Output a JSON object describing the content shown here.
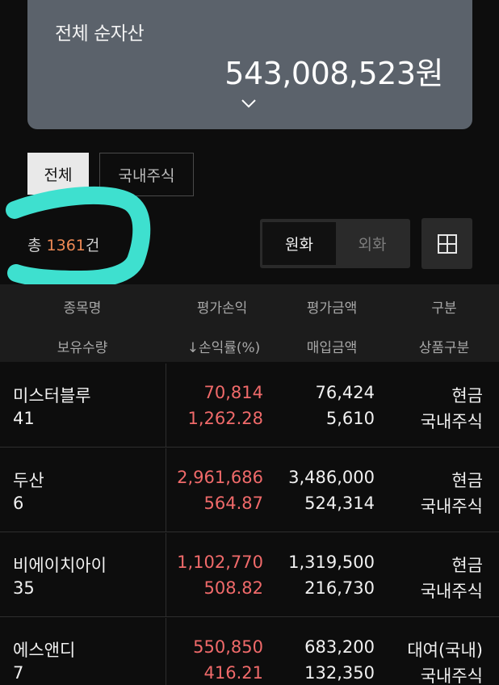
{
  "summary": {
    "title": "전체 순자산",
    "amount": "543,008,523원"
  },
  "tabs": {
    "all": "전체",
    "domestic": "국내주식"
  },
  "count": {
    "prefix": "총 ",
    "value": "1361",
    "suffix": "건"
  },
  "currency": {
    "krw": "원화",
    "fx": "외화"
  },
  "headers": {
    "row1": [
      "종목명",
      "평가손익",
      "평가금액",
      "구분"
    ],
    "row2": [
      "보유수량",
      "↓손익률(%)",
      "매입금액",
      "상품구분"
    ]
  },
  "holdings": [
    {
      "name": "미스터블루",
      "qty": "41",
      "pl": "70,814",
      "rate": "1,262.28",
      "eval": "76,424",
      "buy": "5,610",
      "type": "현금",
      "ptype": "국내주식"
    },
    {
      "name": "두산",
      "qty": "6",
      "pl": "2,961,686",
      "rate": "564.87",
      "eval": "3,486,000",
      "buy": "524,314",
      "type": "현금",
      "ptype": "국내주식"
    },
    {
      "name": "비에이치아이",
      "qty": "35",
      "pl": "1,102,770",
      "rate": "508.82",
      "eval": "1,319,500",
      "buy": "216,730",
      "type": "현금",
      "ptype": "국내주식"
    },
    {
      "name": "에스앤디",
      "qty": "7",
      "pl": "550,850",
      "rate": "416.21",
      "eval": "683,200",
      "buy": "132,350",
      "type": "대여(국내)",
      "ptype": "국내주식"
    }
  ],
  "colors": {
    "profit": "#f06a6a",
    "accent_count": "#f08a55",
    "scribble": "#3ee0cf",
    "card": "#5b626b"
  },
  "icons": {
    "expand": "chevron-down-icon",
    "view_toggle": "grid-icon"
  }
}
